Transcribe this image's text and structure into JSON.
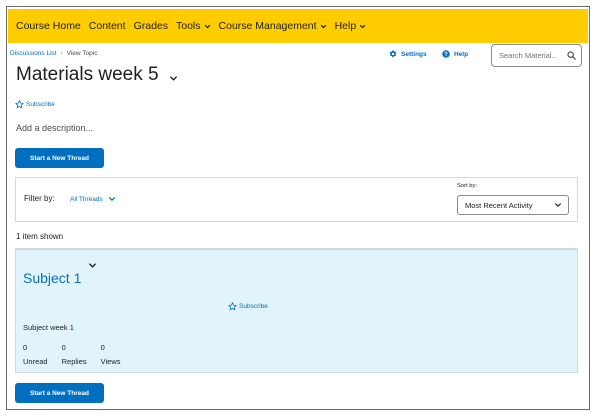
{
  "nav": {
    "items": [
      {
        "label": "Course Home",
        "dropdown": false
      },
      {
        "label": "Content",
        "dropdown": false
      },
      {
        "label": "Grades",
        "dropdown": false
      },
      {
        "label": "Tools",
        "dropdown": true
      },
      {
        "label": "Course Management",
        "dropdown": true
      },
      {
        "label": "Help",
        "dropdown": true
      }
    ],
    "background": "#ffcc00"
  },
  "breadcrumb": {
    "link": "Discussions List",
    "current": "View Topic"
  },
  "utilities": {
    "settings_label": "Settings",
    "help_label": "Help"
  },
  "search": {
    "placeholder": "Search Material..."
  },
  "page": {
    "title": "Materials week 5",
    "subscribe_label": "Subscribe",
    "add_description": "Add a description...",
    "new_thread_label": "Start a New Thread"
  },
  "filter": {
    "label": "Filter by:",
    "value": "All Threads",
    "sort_label": "Sort by:",
    "sort_value": "Most Recent Activity"
  },
  "list": {
    "count_text": "1 item shown",
    "threads": [
      {
        "title": "Subject 1",
        "subscribe_label": "Subscribe",
        "description": "Subject week 1",
        "stats": [
          {
            "value": "0",
            "label": "Unread"
          },
          {
            "value": "0",
            "label": "Replies"
          },
          {
            "value": "0",
            "label": "Views"
          }
        ]
      }
    ]
  },
  "colors": {
    "accent": "#006fbf",
    "card_bg": "#e2f4fb"
  }
}
